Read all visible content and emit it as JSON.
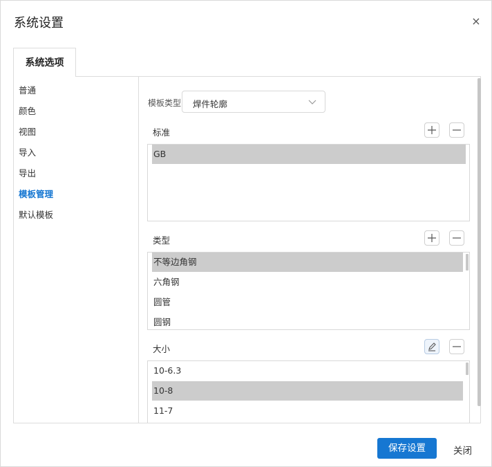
{
  "dialog": {
    "title": "系统设置",
    "close_icon": "×"
  },
  "tab": {
    "label": "系统选项"
  },
  "sidebar": {
    "items": [
      {
        "label": "普通"
      },
      {
        "label": "颜色"
      },
      {
        "label": "视图"
      },
      {
        "label": "导入"
      },
      {
        "label": "导出"
      },
      {
        "label": "模板管理",
        "active": true
      },
      {
        "label": "默认模板"
      }
    ]
  },
  "template_type": {
    "label": "模板类型:",
    "value": "焊件轮廓"
  },
  "standard": {
    "label": "标准",
    "items": [
      "GB"
    ],
    "selected": "GB"
  },
  "category": {
    "label": "类型",
    "items": [
      "不等边角钢",
      "六角钢",
      "圆管",
      "圆钢"
    ],
    "selected": "不等边角钢"
  },
  "size": {
    "label": "大小",
    "items": [
      "10-6.3",
      "10-8",
      "11-7"
    ],
    "selected": "10-8"
  },
  "footer": {
    "save_label": "保存设置",
    "close_label": "关闭"
  },
  "colors": {
    "accent": "#1677d2",
    "selected_row": "#cccccc"
  },
  "icons": [
    "close-icon",
    "chevron-down-icon",
    "plus-icon",
    "minus-icon",
    "edit-icon"
  ]
}
